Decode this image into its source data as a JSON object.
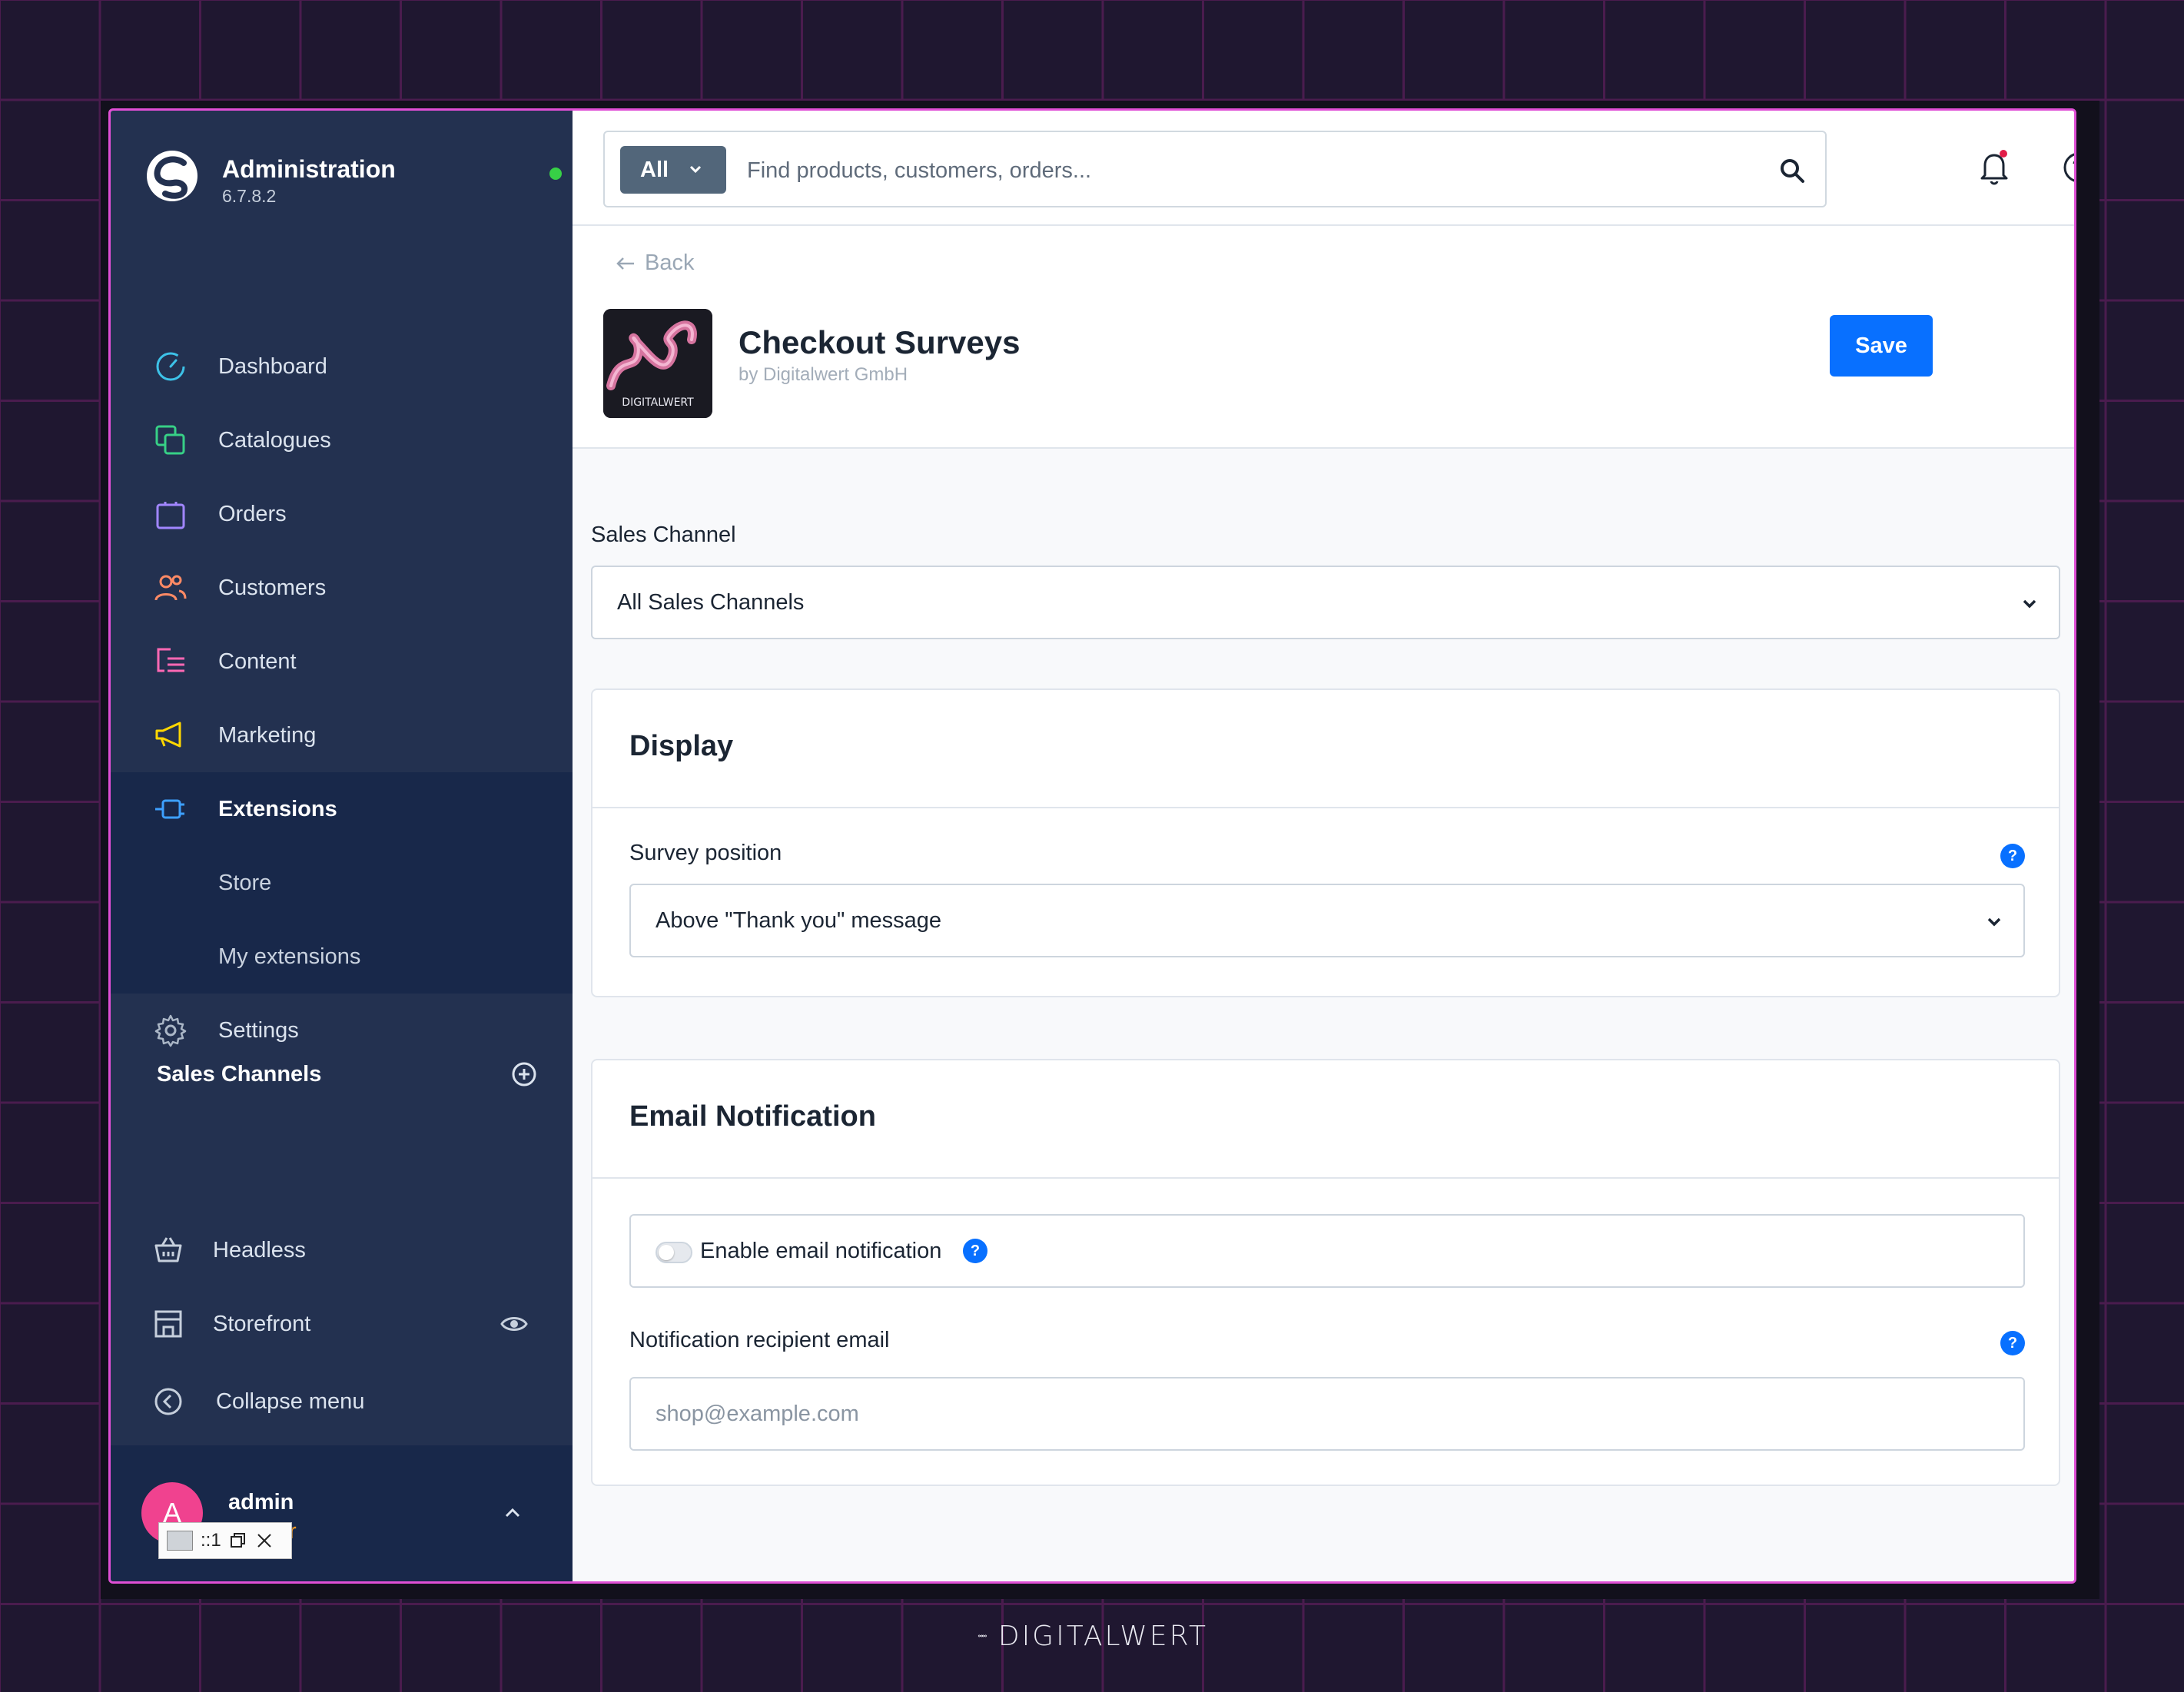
{
  "brand": {
    "title": "Administration",
    "version": "6.7.8.2",
    "status_color": "#37d046"
  },
  "nav": {
    "items": [
      {
        "label": "Dashboard",
        "icon": "dashboard-gauge-icon",
        "color": "#3dc2e8"
      },
      {
        "label": "Catalogues",
        "icon": "catalogues-copy-icon",
        "color": "#37d086"
      },
      {
        "label": "Orders",
        "icon": "orders-bag-icon",
        "color": "#a186ff"
      },
      {
        "label": "Customers",
        "icon": "customers-users-icon",
        "color": "#ff8a65"
      },
      {
        "label": "Content",
        "icon": "content-list-icon",
        "color": "#ff68b4"
      },
      {
        "label": "Marketing",
        "icon": "marketing-megaphone-icon",
        "color": "#ffd700"
      },
      {
        "label": "Extensions",
        "icon": "extensions-plug-icon",
        "color": "#3da0ff"
      }
    ],
    "sub_items": [
      "Store",
      "My extensions"
    ],
    "settings": "Settings"
  },
  "sales_channels": {
    "title": "Sales Channels",
    "items": [
      {
        "label": "Headless",
        "icon": "basket-icon"
      },
      {
        "label": "Storefront",
        "icon": "storefront-icon"
      }
    ]
  },
  "collapse_label": "Collapse menu",
  "user": {
    "initial": "A",
    "name": "admin",
    "role": "istrator"
  },
  "popup": {
    "ratio": "::1"
  },
  "search": {
    "scope": "All",
    "placeholder": "Find products, customers, orders..."
  },
  "header": {
    "back": "Back",
    "title": "Checkout Surveys",
    "vendor": "by Digitalwert GmbH",
    "save": "Save",
    "logo_text": "DIGITALWERT"
  },
  "sales_channel_field": {
    "label": "Sales Channel",
    "value": "All Sales Channels"
  },
  "display_card": {
    "title": "Display",
    "field_label": "Survey position",
    "field_value": "Above \"Thank you\" message"
  },
  "email_card": {
    "title": "Email Notification",
    "toggle_label": "Enable email notification",
    "toggle_on": false,
    "recipient_label": "Notification recipient email",
    "recipient_placeholder": "shop@example.com"
  },
  "help_mark": "?",
  "footer": {
    "brand": "DIGITALWERT"
  },
  "colors": {
    "accent": "#0870ff",
    "sidebar": "#233150",
    "frame_border": "#e04fd6"
  }
}
